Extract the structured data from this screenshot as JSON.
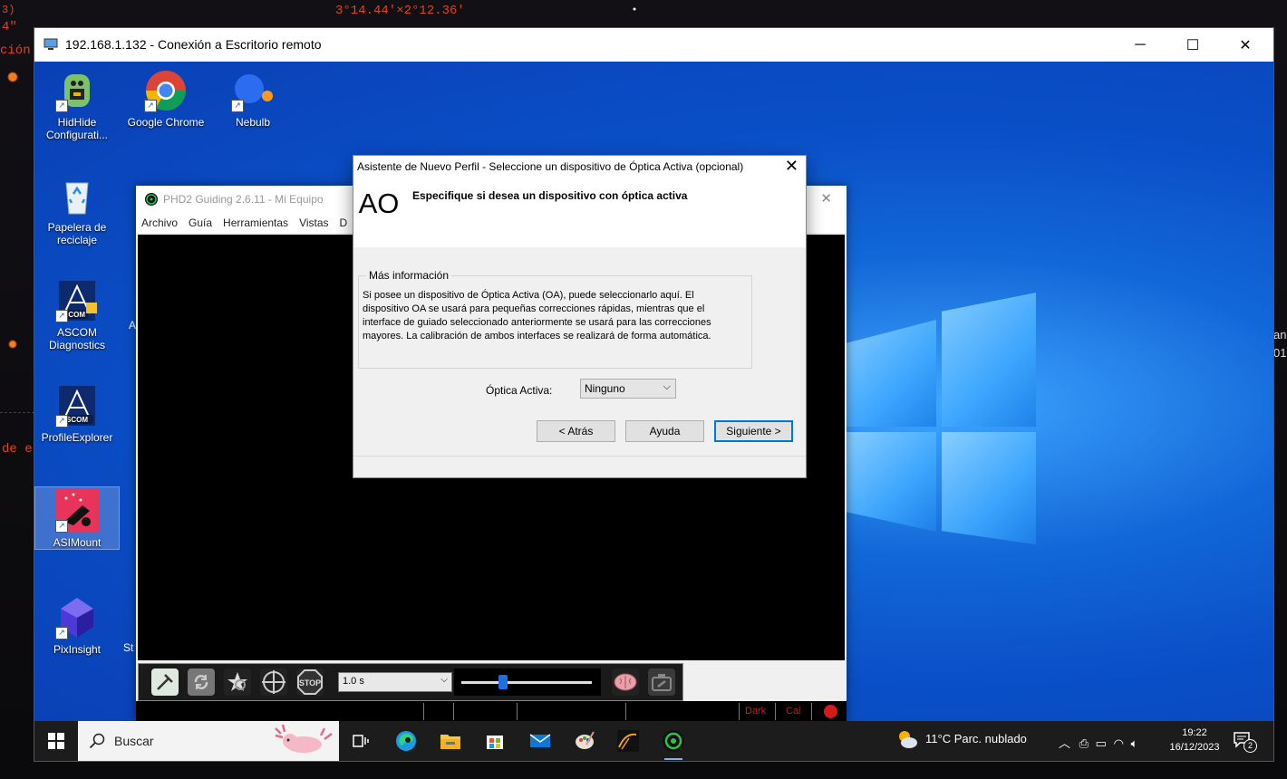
{
  "outer": {
    "coord_text": "3°14.44'×2°12.36'",
    "left_texts": [
      "3)",
      "4\"",
      "ción",
      "de e"
    ],
    "right_texts": [
      "an",
      "01"
    ]
  },
  "rdp": {
    "title": "192.168.1.132 - Conexión a Escritorio remoto",
    "minimize": "─",
    "maximize": "☐",
    "close": "✕"
  },
  "desktop_icons": [
    {
      "name": "hidhide",
      "label": "HidHide Configurati...",
      "icon": "hidhide-icon"
    },
    {
      "name": "chrome",
      "label": "Google Chrome",
      "icon": "chrome-icon"
    },
    {
      "name": "nebulb",
      "label": "Nebulb",
      "icon": "nebulb-icon"
    },
    {
      "name": "recycle",
      "label": "Papelera de reciclaje",
      "icon": "recycle-bin-icon"
    },
    {
      "name": "ascom-diag",
      "label": "ASCOM Diagnostics",
      "icon": "ascom-icon"
    },
    {
      "name": "profile-explorer",
      "label": "ProfileExplorer",
      "icon": "ascom-icon"
    },
    {
      "name": "asimount",
      "label": "ASIMount",
      "icon": "asimount-icon"
    },
    {
      "name": "pixinsight",
      "label": "PixInsight",
      "icon": "pixinsight-icon"
    }
  ],
  "partial_desktop_text": {
    "a": "A",
    "st": "St"
  },
  "phd2": {
    "title": "PHD2 Guiding 2.6.11 - Mi Equipo",
    "close": "✕",
    "menu": [
      "Archivo",
      "Guía",
      "Herramientas",
      "Vistas",
      "D"
    ],
    "exposure": "1.0 s",
    "slider_fraction": 0.32,
    "stop_label": "STOP",
    "status": {
      "dark": "Dark",
      "cal": "Cal"
    }
  },
  "wizard": {
    "title": "Asistente de Nuevo Perfil - Seleccione un dispositivo de Óptica Activa (opcional)",
    "close": "✕",
    "logo_text": "AO",
    "heading": "Especifique si desea un dispositivo con óptica activa",
    "group_title": "Más información",
    "info": "Si posee un dispositivo de Óptica Activa (OA), puede seleccionarlo aquí. El dispositivo OA se usará para pequeñas correcciones rápidas, mientras que el interface de guiado seleccionado anteriormente se usará para las correcciones mayores. La calibración de ambos interfaces se realizará de forma automática.",
    "oa_label": "Óptica Activa:",
    "oa_value": "Ninguno",
    "buttons": {
      "back": "< Atrás",
      "help": "Ayuda",
      "next": "Siguiente >"
    }
  },
  "taskbar": {
    "search_placeholder": "Buscar",
    "weather": "11°C  Parc. nublado",
    "time": "19:22",
    "date": "16/12/2023",
    "notifications": "2"
  },
  "colors": {
    "desktop_blue": "#0a4fc7",
    "accent": "#0078d7"
  }
}
